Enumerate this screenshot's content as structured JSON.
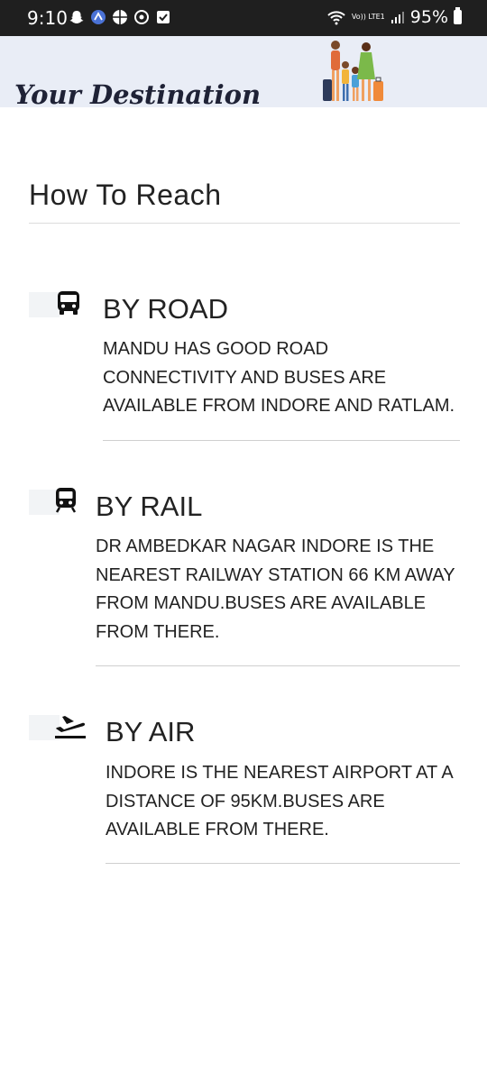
{
  "status_bar": {
    "time": "9:10",
    "network_label": "Vo)) LTE1",
    "battery": "95%"
  },
  "header": {
    "title": "Your Destination"
  },
  "section": {
    "title": "How To Reach"
  },
  "modes": [
    {
      "icon": "bus-icon",
      "heading": "BY ROAD",
      "text": "MANDU HAS GOOD ROAD CONNECTIVITY AND BUSES ARE AVAILABLE FROM INDORE AND RATLAM."
    },
    {
      "icon": "train-icon",
      "heading": "BY RAIL",
      "text": "DR AMBEDKAR NAGAR INDORE IS THE NEAREST RAILWAY STATION 66 KM AWAY FROM MANDU.BUSES ARE AVAILABLE FROM THERE."
    },
    {
      "icon": "flight-takeoff-icon",
      "heading": "BY AIR",
      "text": "INDORE IS THE NEAREST AIRPORT AT A DISTANCE OF 95KM.BUSES ARE AVAILABLE FROM THERE."
    }
  ]
}
